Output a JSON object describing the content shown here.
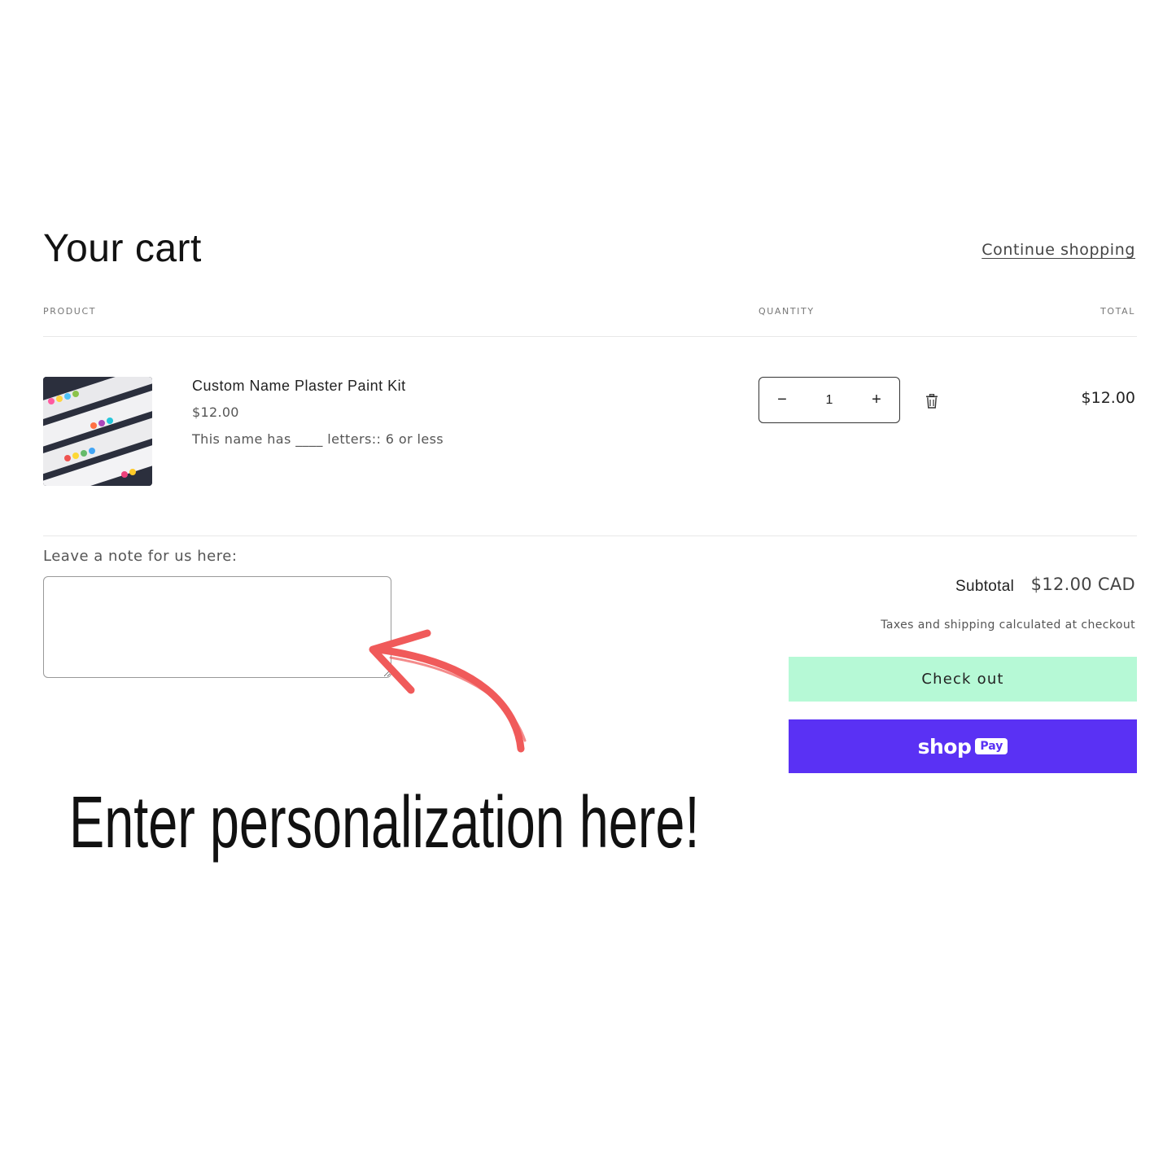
{
  "cart": {
    "title": "Your cart",
    "continue_label": "Continue shopping"
  },
  "columns": {
    "product": "PRODUCT",
    "quantity": "QUANTITY",
    "total": "TOTAL"
  },
  "item": {
    "name": "Custom Name Plaster Paint Kit",
    "price": "$12.00",
    "option": "This name has ____ letters:: 6 or less",
    "quantity": "1",
    "decrease_icon": "minus-icon",
    "increase_icon": "plus-icon",
    "remove_icon": "trash-icon",
    "line_total": "$12.00",
    "image_icon": "product-thumbnail"
  },
  "note": {
    "label": "Leave a note for us here:",
    "value": ""
  },
  "summary": {
    "subtotal_label": "Subtotal",
    "subtotal_value": "$12.00 CAD",
    "tax_note": "Taxes and shipping calculated at checkout",
    "checkout_label": "Check out",
    "shop_word": "shop",
    "pay_badge": "Pay"
  },
  "promo": {
    "text": "Enter personalization here!",
    "arrow_icon": "curved-arrow-icon"
  },
  "colors": {
    "checkout_bg": "#b6f9d6",
    "shoppay_bg": "#5a31f4",
    "arrow": "#f05a5a"
  }
}
